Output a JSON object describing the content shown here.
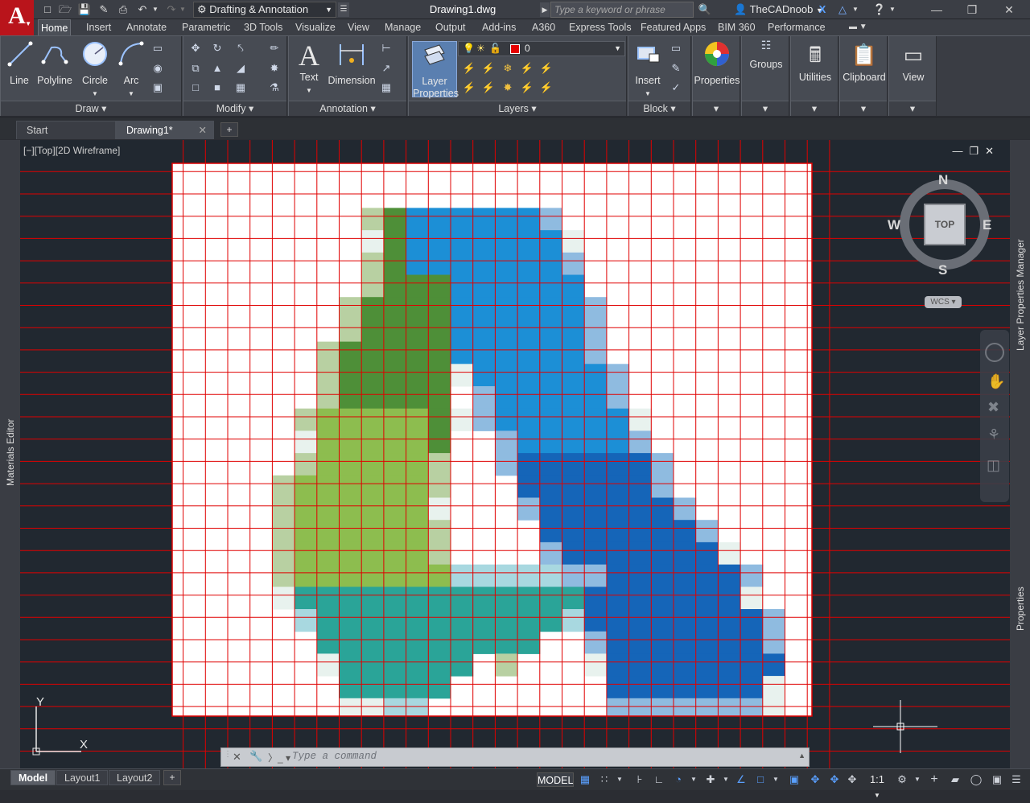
{
  "title_bar": {
    "app_logo": "A",
    "workspace": "Drafting & Annotation",
    "document": "Drawing1.dwg",
    "search_placeholder": "Type a keyword or phrase",
    "user": "TheCADnoob"
  },
  "ribbon_tabs": [
    "Home",
    "Insert",
    "Annotate",
    "Parametric",
    "3D Tools",
    "Visualize",
    "View",
    "Manage",
    "Output",
    "Add-ins",
    "A360",
    "Express Tools",
    "Featured Apps",
    "BIM 360",
    "Performance"
  ],
  "ribbon_active_tab": "Home",
  "panels": {
    "draw": {
      "title": "Draw",
      "tools": [
        "Line",
        "Polyline",
        "Circle",
        "Arc"
      ]
    },
    "modify": {
      "title": "Modify"
    },
    "annotation": {
      "title": "Annotation",
      "tools": [
        "Text",
        "Dimension"
      ]
    },
    "layers": {
      "title": "Layers",
      "layer_properties": "Layer Properties",
      "current_layer": "0",
      "current_color": "#e60000"
    },
    "block": {
      "title": "Block",
      "insert": "Insert"
    },
    "properties": "Properties",
    "groups": "Groups",
    "utilities": "Utilities",
    "clipboard": "Clipboard",
    "view": "View"
  },
  "file_tabs": [
    "Start",
    "Drawing1*"
  ],
  "viewport": {
    "label": "[−][Top][2D Wireframe]",
    "viewcube": {
      "north": "N",
      "south": "S",
      "east": "E",
      "west": "W",
      "top": "TOP",
      "wcs": "WCS"
    },
    "ucs_x": "X",
    "ucs_y": "Y"
  },
  "side_palettes": {
    "left": "Materials Editor",
    "right_top": "Layer Properties Manager",
    "right_bottom": "Properties"
  },
  "command_line": {
    "placeholder": "Type a command"
  },
  "layout_tabs": [
    "Model",
    "Layout1",
    "Layout2"
  ],
  "status_bar": {
    "model": "MODEL",
    "scale": "1:1"
  },
  "colors": {
    "accent_red": "#e00000",
    "grid_line": "#e00000",
    "app_red": "#b9141b"
  },
  "pixel_image": {
    "legend": {
      ".": "#ffffff",
      "g": "#4e8f38",
      "l": "#8dbd4f",
      "t": "#2aa498",
      "b": "#1c8fd6",
      "d": "#1565b8",
      "c": "#e8f2ee",
      "s": "#b8d0a2",
      "a": "#a8d8e0",
      "p": "#8fbbe0"
    },
    "rows": [
      "..........................",
      "..........................",
      "........sgbbbbbbp.........",
      "........cgbbbbbbbc........",
      "........sgbbbbbbbp........",
      "........sgggbbbbbb........",
      ".......sggggbbbbbbp.......",
      ".......sggggbbbbbbp.......",
      "......sgggggbbbbbbp.......",
      "......sgggggcbbbbbbp......",
      "......sggggg.pbbbbbp......",
      ".....slllllgcpbbbbbbc.....",
      ".....clllllg..pbbbbbp.....",
      ".....sllllls..pddddddp....",
      "....slllllls...ddddddp....",
      "....sllllllc...pddddddp...",
      "....slllllls....dddddddp..",
      "....slllllls....pdddddddc.",
      "....slllllllaaaaappddddddp.",
      "....ctttttttttttttdddddddc.",
      ".....atttttttttttaddddddddp",
      "......tttttttttt..pdddddddp",
      "......ctttttt.s...cdddddddd",
      ".......ttttt.......dddddddc",
      ".......ccaa........pppppppc"
    ]
  }
}
